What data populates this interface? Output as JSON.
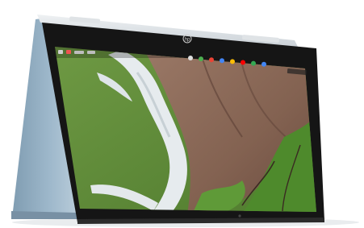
{
  "photo": {
    "subject": "convertible-laptop",
    "brand_mark": "hp",
    "mode": "tent",
    "colors": {
      "background": "#ffffff",
      "chassis_blue": "#9fb9cc",
      "chassis_blue_dark": "#7f9cb1",
      "bezel": "#151515",
      "hinge_silver": "#d9dde0",
      "land_green": "#5e8a3a",
      "land_green_light": "#7aa64c",
      "river_white": "#e8ecef",
      "desert_brown": "#8c6a58",
      "desert_dark": "#6e4f43"
    }
  },
  "screen": {
    "wallpaper": "aerial-river-landscape",
    "shelf_icons": [
      {
        "name": "launcher-icon",
        "color": "#dedede"
      },
      {
        "name": "chrome-icon",
        "color": "#4caf50"
      },
      {
        "name": "gmail-icon",
        "color": "#ea4335"
      },
      {
        "name": "docs-icon",
        "color": "#4285f4"
      },
      {
        "name": "drive-icon",
        "color": "#fbbc05"
      },
      {
        "name": "youtube-icon",
        "color": "#ff0000"
      },
      {
        "name": "play-store-icon",
        "color": "#34a853"
      },
      {
        "name": "files-icon",
        "color": "#4285f4"
      }
    ]
  }
}
